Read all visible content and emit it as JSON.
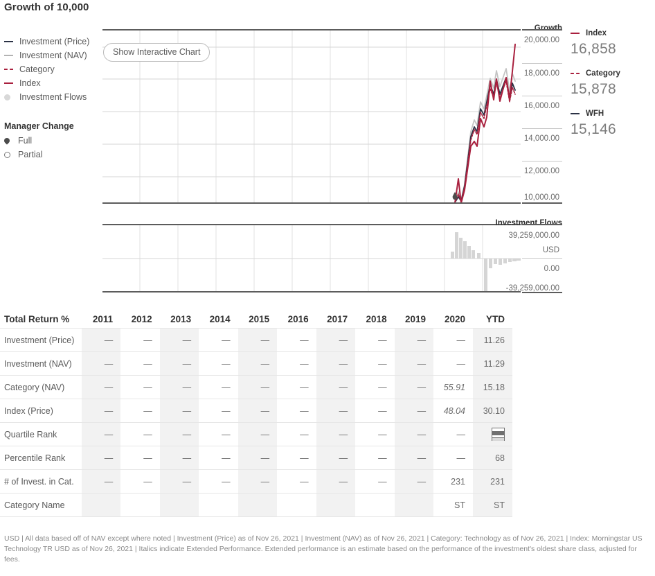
{
  "title": "Growth of 10,000",
  "legend": {
    "items": [
      {
        "label": "Investment (Price)",
        "mark": "line-navy",
        "color": "#2b3245"
      },
      {
        "label": "Investment (NAV)",
        "mark": "line-gray",
        "color": "#b3b3b3"
      },
      {
        "label": "Category",
        "mark": "line-dashed-red",
        "color": "#a9203e"
      },
      {
        "label": "Index",
        "mark": "line-red",
        "color": "#a9203e"
      },
      {
        "label": "Investment Flows",
        "mark": "dot-gray",
        "color": "#d8d8d8"
      }
    ]
  },
  "manager_change": {
    "title": "Manager Change",
    "items": [
      {
        "label": "Full",
        "mark": "pin-filled"
      },
      {
        "label": "Partial",
        "mark": "pin-hollow"
      }
    ]
  },
  "buttons": {
    "show_interactive_chart": "Show Interactive Chart"
  },
  "values_panel": [
    {
      "name": "Index",
      "value": "16,858",
      "mark": "line-red",
      "color": "#a9203e"
    },
    {
      "name": "Category",
      "value": "15,878",
      "mark": "line-dashed-red",
      "color": "#a9203e"
    },
    {
      "name": "WFH",
      "value": "15,146",
      "mark": "line-navy",
      "color": "#2b3245"
    }
  ],
  "chart_data": [
    {
      "type": "line",
      "title": "Growth of 10,000",
      "ylabel": "Growth",
      "xlabel": "",
      "ylim": [
        9000,
        20800
      ],
      "yticks": [
        "20,000.00",
        "18,000.00",
        "16,000.00",
        "14,000.00",
        "12,000.00",
        "10,000.00"
      ],
      "ytick_values": [
        20000,
        18000,
        16000,
        14000,
        12000,
        10000
      ],
      "grid": true,
      "legend_position": "left",
      "x": [
        2011,
        2012,
        2013,
        2014,
        2015,
        2016,
        2017,
        2018,
        2019,
        2020,
        2021
      ],
      "series": [
        {
          "name": "Index",
          "color": "#a9203e",
          "style": "solid",
          "points": [
            [
              2020.0,
              10000
            ],
            [
              2020.08,
              11150
            ],
            [
              2020.17,
              9750
            ],
            [
              2020.25,
              10550
            ],
            [
              2020.42,
              13250
            ],
            [
              2020.5,
              13550
            ],
            [
              2020.58,
              13250
            ],
            [
              2020.67,
              14950
            ],
            [
              2020.75,
              14450
            ],
            [
              2020.83,
              15050
            ],
            [
              2020.92,
              17250
            ],
            [
              2021.0,
              16100
            ],
            [
              2021.08,
              17350
            ],
            [
              2021.17,
              16000
            ],
            [
              2021.33,
              17500
            ],
            [
              2021.42,
              16858
            ],
            [
              2021.5,
              19200
            ]
          ]
        },
        {
          "name": "Category",
          "color": "#a9203e",
          "style": "dashed",
          "final_value": 15878
        },
        {
          "name": "Investment (Price) / WFH",
          "color": "#2b3245",
          "style": "solid",
          "points": [
            [
              2020.0,
              9900
            ],
            [
              2020.08,
              10250
            ],
            [
              2020.17,
              9800
            ],
            [
              2020.25,
              10800
            ],
            [
              2020.42,
              13850
            ],
            [
              2020.5,
              14450
            ],
            [
              2020.58,
              14150
            ],
            [
              2020.67,
              15550
            ],
            [
              2020.75,
              15150
            ],
            [
              2020.83,
              15950
            ],
            [
              2020.92,
              17000
            ],
            [
              2021.0,
              16400
            ],
            [
              2021.08,
              17350
            ],
            [
              2021.17,
              16400
            ],
            [
              2021.33,
              17550
            ],
            [
              2021.5,
              16550
            ]
          ]
        },
        {
          "name": "Investment (NAV)",
          "color": "#b3b3b3",
          "style": "solid",
          "points": [
            [
              2020.0,
              9950
            ],
            [
              2020.08,
              10350
            ],
            [
              2020.17,
              9900
            ],
            [
              2020.25,
              10900
            ],
            [
              2020.42,
              14200
            ],
            [
              2020.5,
              14900
            ],
            [
              2020.58,
              14550
            ],
            [
              2020.67,
              16000
            ],
            [
              2020.75,
              15550
            ],
            [
              2020.83,
              16400
            ],
            [
              2020.92,
              17450
            ],
            [
              2021.0,
              16850
            ],
            [
              2021.08,
              17900
            ],
            [
              2021.17,
              16950
            ],
            [
              2021.33,
              18050
            ],
            [
              2021.5,
              17050
            ]
          ]
        }
      ],
      "markers": [
        {
          "type": "manager-change-full",
          "x": 2020.02,
          "y": 10120
        }
      ]
    },
    {
      "type": "bar",
      "title": "Investment Flows",
      "ylabel": "Investment Flows",
      "currency": "USD",
      "yticks": [
        "39,259,000.00",
        "USD",
        "0.00",
        "-39,259,000.00"
      ],
      "ylim": [
        -39259000,
        39259000
      ],
      "grid": true,
      "bars": [
        {
          "x": 2020.04,
          "value": 8500000
        },
        {
          "x": 2020.08,
          "value": 31000000
        },
        {
          "x": 2020.12,
          "value": 24000000
        },
        {
          "x": 2020.16,
          "value": 20000000
        },
        {
          "x": 2020.2,
          "value": 14000000
        },
        {
          "x": 2020.24,
          "value": 9500000
        },
        {
          "x": 2020.32,
          "value": 6500000
        },
        {
          "x": 2020.4,
          "value": -39259000
        },
        {
          "x": 2020.46,
          "value": -11000000
        },
        {
          "x": 2020.52,
          "value": -6500000
        },
        {
          "x": 2020.58,
          "value": -7000000
        },
        {
          "x": 2020.64,
          "value": -5500000
        },
        {
          "x": 2020.7,
          "value": -4500000
        },
        {
          "x": 2020.78,
          "value": -3000000
        },
        {
          "x": 2020.86,
          "value": -2000000
        }
      ]
    }
  ],
  "table": {
    "title": "Total Return %",
    "columns": [
      "2011",
      "2012",
      "2013",
      "2014",
      "2015",
      "2016",
      "2017",
      "2018",
      "2019",
      "2020",
      "YTD"
    ],
    "rows": [
      {
        "label": "Investment (Price)",
        "cells": [
          {
            "v": "—"
          },
          {
            "v": "—"
          },
          {
            "v": "—"
          },
          {
            "v": "—"
          },
          {
            "v": "—"
          },
          {
            "v": "—"
          },
          {
            "v": "—"
          },
          {
            "v": "—"
          },
          {
            "v": "—"
          },
          {
            "v": "—"
          },
          {
            "v": "11.26"
          }
        ]
      },
      {
        "label": "Investment (NAV)",
        "cells": [
          {
            "v": "—"
          },
          {
            "v": "—"
          },
          {
            "v": "—"
          },
          {
            "v": "—"
          },
          {
            "v": "—"
          },
          {
            "v": "—"
          },
          {
            "v": "—"
          },
          {
            "v": "—"
          },
          {
            "v": "—"
          },
          {
            "v": "—"
          },
          {
            "v": "11.29"
          }
        ]
      },
      {
        "label": "Category (NAV)",
        "cells": [
          {
            "v": "—"
          },
          {
            "v": "—"
          },
          {
            "v": "—"
          },
          {
            "v": "—"
          },
          {
            "v": "—"
          },
          {
            "v": "—"
          },
          {
            "v": "—"
          },
          {
            "v": "—"
          },
          {
            "v": "—"
          },
          {
            "v": "55.91",
            "italic": true
          },
          {
            "v": "15.18"
          }
        ]
      },
      {
        "label": "Index (Price)",
        "cells": [
          {
            "v": "—"
          },
          {
            "v": "—"
          },
          {
            "v": "—"
          },
          {
            "v": "—"
          },
          {
            "v": "—"
          },
          {
            "v": "—"
          },
          {
            "v": "—"
          },
          {
            "v": "—"
          },
          {
            "v": "—"
          },
          {
            "v": "48.04",
            "italic": true
          },
          {
            "v": "30.10"
          }
        ]
      },
      {
        "label": "Quartile Rank",
        "cells": [
          {
            "v": "—"
          },
          {
            "v": "—"
          },
          {
            "v": "—"
          },
          {
            "v": "—"
          },
          {
            "v": "—"
          },
          {
            "v": "—"
          },
          {
            "v": "—"
          },
          {
            "v": "—"
          },
          {
            "v": "—"
          },
          {
            "v": "—"
          },
          {
            "v": "",
            "icon": "quartile-rank-icon"
          }
        ]
      },
      {
        "label": "Percentile Rank",
        "cells": [
          {
            "v": "—"
          },
          {
            "v": "—"
          },
          {
            "v": "—"
          },
          {
            "v": "—"
          },
          {
            "v": "—"
          },
          {
            "v": "—"
          },
          {
            "v": "—"
          },
          {
            "v": "—"
          },
          {
            "v": "—"
          },
          {
            "v": "—"
          },
          {
            "v": "68"
          }
        ]
      },
      {
        "label": "# of Invest. in Cat.",
        "cells": [
          {
            "v": "—"
          },
          {
            "v": "—"
          },
          {
            "v": "—"
          },
          {
            "v": "—"
          },
          {
            "v": "—"
          },
          {
            "v": "—"
          },
          {
            "v": "—"
          },
          {
            "v": "—"
          },
          {
            "v": "—"
          },
          {
            "v": "231"
          },
          {
            "v": "231"
          }
        ]
      },
      {
        "label": "Category Name",
        "cells": [
          {
            "v": ""
          },
          {
            "v": ""
          },
          {
            "v": ""
          },
          {
            "v": ""
          },
          {
            "v": ""
          },
          {
            "v": ""
          },
          {
            "v": ""
          },
          {
            "v": ""
          },
          {
            "v": ""
          },
          {
            "v": "ST"
          },
          {
            "v": "ST"
          }
        ]
      }
    ]
  },
  "footnote": "USD | All data based off of NAV except where noted  | Investment (Price) as of Nov 26, 2021 | Investment (NAV) as of Nov 26, 2021 | Category: Technology as of Nov 26, 2021 | Index: Morningstar US Technology TR USD as of Nov 26, 2021  | Italics indicate Extended Performance. Extended performance is an estimate based on the performance of the investment's oldest share class, adjusted for fees."
}
